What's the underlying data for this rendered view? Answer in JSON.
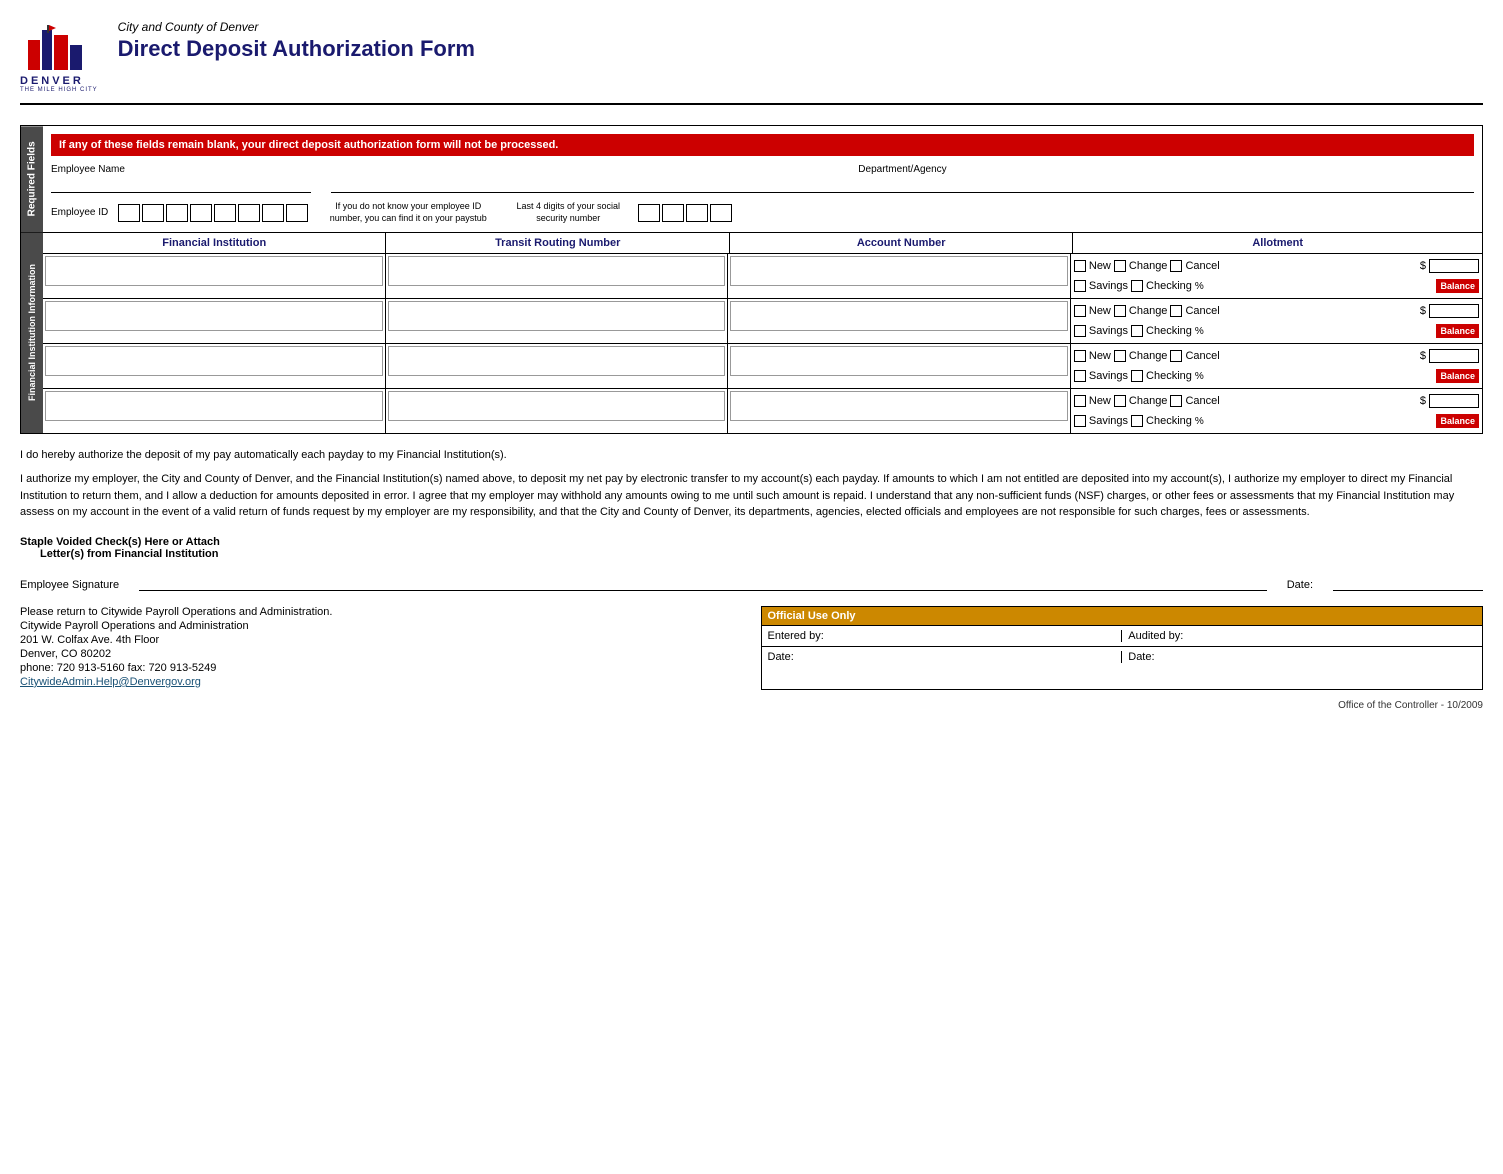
{
  "header": {
    "city_county": "City and County of Denver",
    "form_title": "Direct Deposit Authorization Form",
    "denver_label": "DENVER",
    "denver_sub": "THE MILE HIGH CITY"
  },
  "warning": {
    "text": "If any of these fields remain blank, your direct deposit authorization form will not be processed."
  },
  "required_fields": {
    "label": "Required Fields",
    "employee_name_label": "Employee Name",
    "department_agency_label": "Department/Agency",
    "employee_id_label": "Employee ID",
    "id_note": "If you do not know your employee ID number, you can find it on your paystub",
    "ssn_note": "Last 4 digits of your social security number"
  },
  "fi_section": {
    "label": "Financial Institution Information",
    "col1": "Financial Institution",
    "col2": "Transit Routing Number",
    "col3": "Account Number",
    "col4": "Allotment",
    "rows": [
      {
        "new_label": "New",
        "change_label": "Change",
        "cancel_label": "Cancel",
        "savings_label": "Savings",
        "checking_label": "Checking",
        "dollar": "$",
        "percent": "%",
        "balance_label": "Balance"
      },
      {
        "new_label": "New",
        "change_label": "Change",
        "cancel_label": "Cancel",
        "savings_label": "Savings",
        "checking_label": "Checking",
        "dollar": "$",
        "percent": "%",
        "balance_label": "Balance"
      },
      {
        "new_label": "New",
        "change_label": "Change",
        "cancel_label": "Cancel",
        "savings_label": "Savings",
        "checking_label": "Checking",
        "dollar": "$",
        "percent": "%",
        "balance_label": "Balance"
      },
      {
        "new_label": "New",
        "change_label": "Change",
        "cancel_label": "Cancel",
        "savings_label": "Savings",
        "checking_label": "Checking",
        "dollar": "$",
        "percent": "%",
        "balance_label": "Balance"
      }
    ]
  },
  "signature_section": {
    "para1": "I do hereby authorize the deposit of my pay automatically each payday to my Financial Institution(s).",
    "para2": "I authorize my employer, the City and County of Denver, and the Financial Institution(s) named above, to deposit my net pay by electronic transfer to my account(s) each payday. If amounts to which I am not entitled are deposited into my account(s), I authorize my employer to direct my Financial Institution to return them, and I allow a deduction for amounts deposited in error. I agree that my employer may withhold any amounts owing to me until such amount is repaid. I understand that any non-sufficient funds (NSF) charges, or other fees or assessments that my Financial Institution may assess on my account in the event of a valid return of funds request by my employer are my responsibility, and that the City and County of Denver, its departments, agencies, elected officials and employees are not responsible for such charges, fees or assessments.",
    "staple1": "Staple Voided Check(s) Here or Attach",
    "staple2": "Letter(s) from Financial Institution",
    "sig_label": "Employee Signature",
    "date_label": "Date:"
  },
  "return_section": {
    "line1": "Please return to Citywide Payroll Operations and Administration.",
    "line2": "Citywide Payroll Operations and Administration",
    "line3": "201 W. Colfax Ave. 4th Floor",
    "line4": "Denver, CO 80202",
    "phone": "phone: 720 913-5160     fax: 720 913-5249",
    "email": "CitywideAdmin.Help@Denvergov.org"
  },
  "official_use": {
    "header": "Official Use Only",
    "entered_by": "Entered by:",
    "audited_by": "Audited by:",
    "date1": "Date:",
    "date2": "Date:"
  },
  "footer": {
    "text": "Office of the Controller - 10/2009"
  }
}
